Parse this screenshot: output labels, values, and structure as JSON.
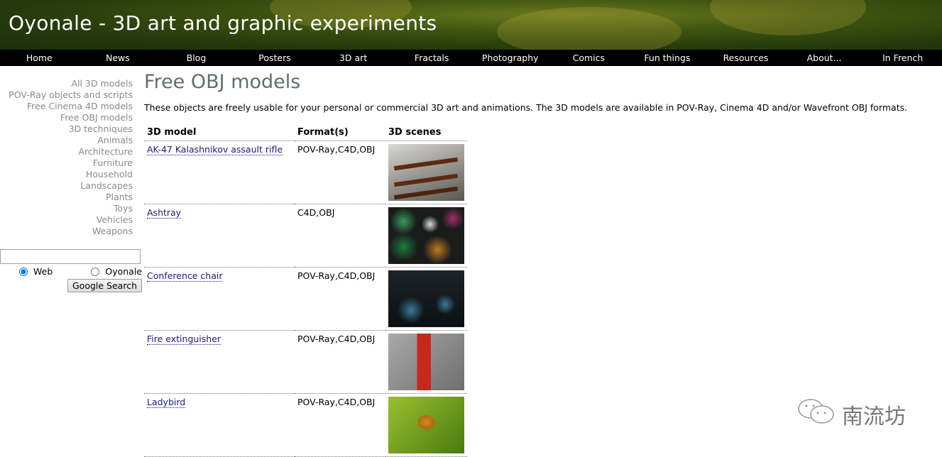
{
  "header": {
    "title": "Oyonale - 3D art and graphic experiments"
  },
  "nav": [
    "Home",
    "News",
    "Blog",
    "Posters",
    "3D art",
    "Fractals",
    "Photography",
    "Comics",
    "Fun things",
    "Resources",
    "About...",
    "In French"
  ],
  "sidebar": [
    "All 3D models",
    "POV-Ray objects and scripts",
    "Free Cinema 4D models",
    "Free OBJ models",
    "3D techniques",
    "Animals",
    "Architecture",
    "Furniture",
    "Household",
    "Landscapes",
    "Plants",
    "Toys",
    "Vehicles",
    "Weapons"
  ],
  "search": {
    "value": "",
    "radio_web": "Web",
    "radio_oyonale": "Oyonale",
    "button": "Google Search"
  },
  "main": {
    "title": "Free OBJ models",
    "intro": "These objects are freely usable for your personal or commercial 3D art and animations. The 3D models are available in POV-Ray, Cinema 4D and/or Wavefront OBJ formats.",
    "columns": [
      "3D model",
      "Format(s)",
      "3D scenes"
    ],
    "rows": [
      {
        "name": "AK-47 Kalashnikov assault rifle",
        "formats": "POV-Ray,C4D,OBJ"
      },
      {
        "name": "Ashtray",
        "formats": "C4D,OBJ"
      },
      {
        "name": "Conference chair",
        "formats": "POV-Ray,C4D,OBJ"
      },
      {
        "name": "Fire extinguisher",
        "formats": "POV-Ray,C4D,OBJ"
      },
      {
        "name": "Ladybird",
        "formats": "POV-Ray,C4D,OBJ"
      }
    ]
  },
  "watermark": "南流坊"
}
